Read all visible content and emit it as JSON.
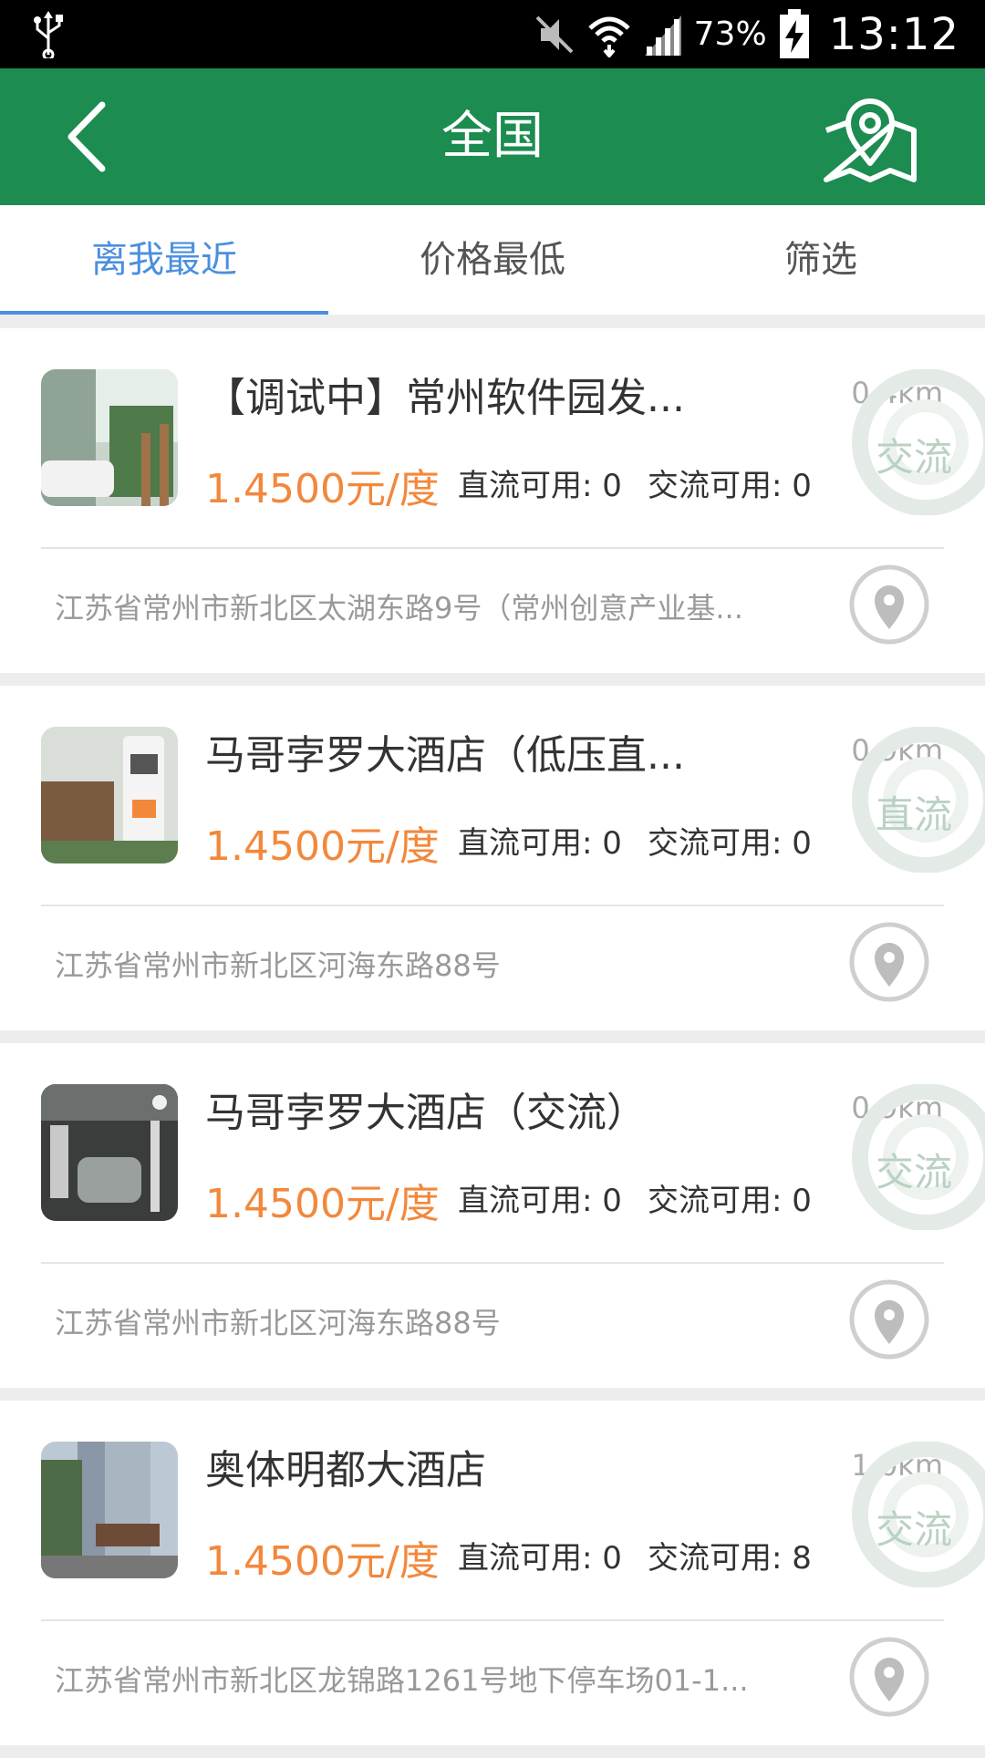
{
  "status_bar": {
    "battery_percent": "73%",
    "time": "13:12",
    "icons": [
      "usb-icon",
      "mute-icon",
      "wifi-icon",
      "signal-icon",
      "battery-charging-icon"
    ]
  },
  "app_bar": {
    "title": "全国",
    "back_icon": "chevron-left-icon",
    "map_icon": "map-location-icon",
    "color": "#1c8c50"
  },
  "tabs": [
    {
      "label": "离我最近",
      "active": true
    },
    {
      "label": "价格最低",
      "active": false
    },
    {
      "label": "筛选",
      "active": false
    }
  ],
  "accent_color": "#4a8fe0",
  "price_color": "#f2883c",
  "stations": [
    {
      "name": "【调试中】常州软件园发...",
      "price": "1.4500元/度",
      "dc": "直流可用: 0",
      "ac": "交流可用: 0",
      "distance": "0.4km",
      "type": "交流",
      "address": "江苏省常州市新北区太湖东路9号（常州创意产业基...",
      "thumb": "parking-outdoor"
    },
    {
      "name": "马哥孛罗大酒店（低压直...",
      "price": "1.4500元/度",
      "dc": "直流可用: 0",
      "ac": "交流可用: 0",
      "distance": "0.9km",
      "type": "直流",
      "address": "江苏省常州市新北区河海东路88号",
      "thumb": "charger-station"
    },
    {
      "name": "马哥孛罗大酒店（交流）",
      "price": "1.4500元/度",
      "dc": "直流可用: 0",
      "ac": "交流可用: 0",
      "distance": "0.9km",
      "type": "交流",
      "address": "江苏省常州市新北区河海东路88号",
      "thumb": "garage"
    },
    {
      "name": "奥体明都大酒店",
      "price": "1.4500元/度",
      "dc": "直流可用: 0",
      "ac": "交流可用: 8",
      "distance": "1.0km",
      "type": "交流",
      "address": "江苏省常州市新北区龙锦路1261号地下停车场01-1...",
      "thumb": "hotel-building"
    }
  ]
}
